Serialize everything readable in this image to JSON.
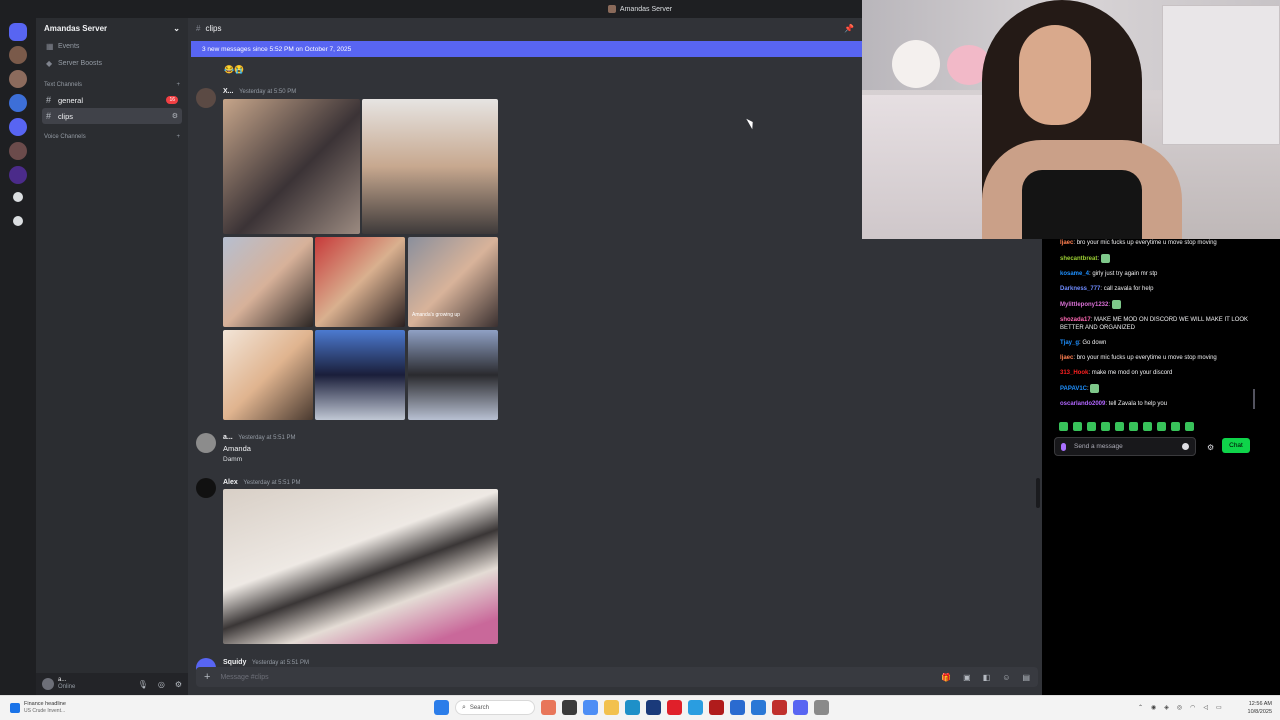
{
  "window": {
    "title": "Amandas Server"
  },
  "server": {
    "name": "Amandas Server"
  },
  "sidebar": {
    "items": [
      {
        "label": "Events",
        "icon": "calendar-icon"
      },
      {
        "label": "Server Boosts",
        "icon": "boost-icon"
      }
    ],
    "text_category": "Text Channels",
    "voice_category": "Voice Channels",
    "channels": [
      {
        "name": "general",
        "badge": "16"
      },
      {
        "name": "clips"
      }
    ]
  },
  "user_panel": {
    "name": "a...",
    "status": "Online"
  },
  "channel": {
    "name": "clips"
  },
  "new_messages": "3 new messages since 5:52 PM on October 7, 2025",
  "messages": [
    {
      "author": "X...",
      "time": "Yesterday at 5:50 PM"
    },
    {
      "author": "a...",
      "time": "Yesterday at 5:51 PM",
      "line1": "Amanda",
      "line2": "Damm"
    },
    {
      "author": "Alex",
      "time": "Yesterday at 5:51 PM"
    },
    {
      "author": "Squidy",
      "time": "Yesterday at 5:51 PM"
    }
  ],
  "image_caption": "Amanda's growing up",
  "composer": {
    "placeholder": "Message #clips"
  },
  "twitch_chat": {
    "lines": [
      {
        "user": "Ijaec",
        "text": ": bro your mic fucks up everytime u move stop moving",
        "color": "#ff7f50"
      },
      {
        "user": "shecantbreat",
        "text": ": ",
        "color": "#9acd32",
        "emote": true
      },
      {
        "user": "kosame_4",
        "text": ": girly just try again mr stp",
        "color": "#1e90ff"
      },
      {
        "user": "Darkness_777",
        "text": ": call zavala for help",
        "color": "#6f8cff"
      },
      {
        "user": "Mylittlepony1232",
        "text": ": ",
        "color": "#da70d6",
        "emote": true
      },
      {
        "user": "shozada17",
        "text": ": MAKE ME MOD ON DISCORD WE WILL MAKE IT LOOK BETTER AND ORGANIZED",
        "color": "#ff69b4"
      },
      {
        "user": "Tjay_g",
        "text": ": Go down",
        "color": "#1e90ff"
      },
      {
        "user": "Ijaec",
        "text": ": bro your mic fucks up everytime u move stop moving",
        "color": "#ff7f50"
      },
      {
        "user": "313_Hook",
        "text": ": make me mod on your discord",
        "color": "#ff2020"
      },
      {
        "user": "PAPAV1C",
        "text": ": ",
        "color": "#1e90ff",
        "emote": true
      },
      {
        "user": "oscarlando2009",
        "text": ": tell Zavala to help you",
        "color": "#b266ff"
      }
    ],
    "input_placeholder": "Send a message",
    "button_label": "Chat"
  },
  "taskbar": {
    "news_title": "Finance headline",
    "news_sub": "US Crude Invent...",
    "search": "Search",
    "time": "12:56 AM",
    "date": "10/8/2025"
  }
}
